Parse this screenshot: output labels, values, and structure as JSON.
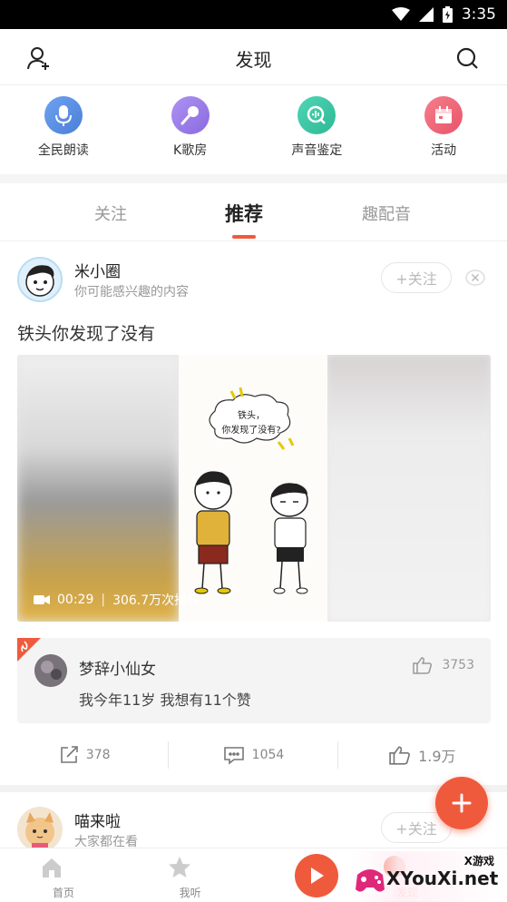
{
  "status_bar": {
    "time": "3:35"
  },
  "header": {
    "title": "发现"
  },
  "categories": [
    {
      "label": "全民朗读",
      "color": "#5b8fe6",
      "icon": "microphone-icon"
    },
    {
      "label": "K歌房",
      "color": "#9b7fe8",
      "icon": "karaoke-mic-icon"
    },
    {
      "label": "声音鉴定",
      "color": "#3cc8a8",
      "icon": "sound-search-icon"
    },
    {
      "label": "活动",
      "color": "#f06a7a",
      "icon": "calendar-icon"
    }
  ],
  "tabs": [
    {
      "label": "关注"
    },
    {
      "label": "推荐"
    },
    {
      "label": "趣配音"
    }
  ],
  "post": {
    "author": "米小圈",
    "subtitle": "你可能感兴趣的内容",
    "follow_label": "+关注",
    "title": "铁头你发现了没有",
    "video": {
      "duration": "00:29",
      "plays": "306.7万次播放",
      "bubble_text_line1": "铁头，",
      "bubble_text_line2": "你发现了没有?"
    },
    "hot_comment": {
      "user": "梦辞小仙女",
      "text": "我今年11岁 我想有11个赞",
      "likes": "3753"
    },
    "actions": {
      "share": "378",
      "comments": "1054",
      "likes": "1.9万"
    }
  },
  "post2": {
    "author": "喵来啦",
    "subtitle": "大家都在看",
    "follow_label": "+关注"
  },
  "bottom_nav": [
    {
      "label": "首页"
    },
    {
      "label": "我听"
    },
    {
      "label": ""
    },
    {
      "label": "发现"
    }
  ],
  "watermark": {
    "top": "X游戏",
    "main": "XYouXi.net"
  },
  "colors": {
    "accent": "#f05a3c"
  }
}
